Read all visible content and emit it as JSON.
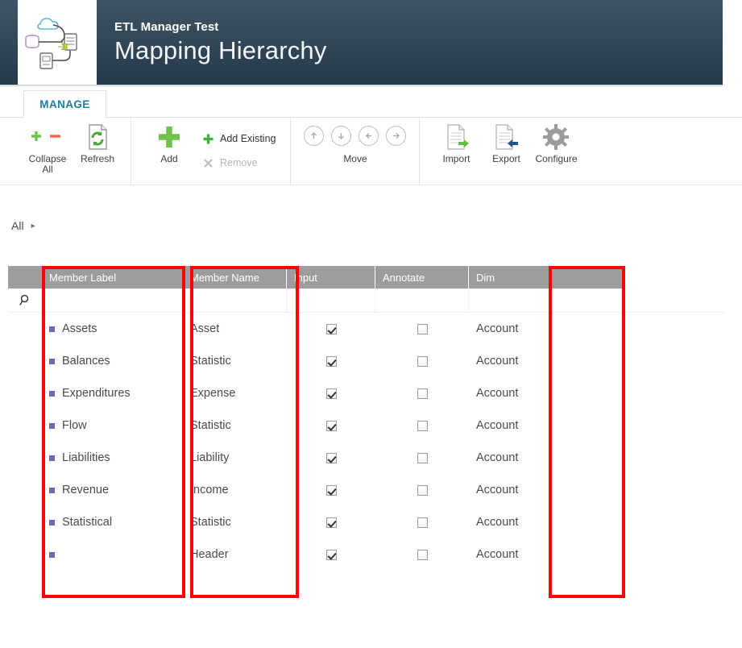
{
  "header": {
    "subtitle": "ETL Manager Test",
    "title": "Mapping Hierarchy",
    "logo_icon": "etl-dataflow-diagram-icon",
    "bg_top_color": "#3e5665",
    "bg_bottom_color": "#25394a"
  },
  "ribbon": {
    "tabs": [
      {
        "label": "MANAGE",
        "active": true
      }
    ],
    "tab_color": "#1a7fa5",
    "groups": [
      {
        "name": "view-group",
        "buttons": [
          {
            "label": "Collapse\nAll",
            "label_line1": "Collapse",
            "label_line2": "All",
            "icon": "expand-collapse-plus-minus-icon",
            "enabled": true
          },
          {
            "label": "Refresh",
            "icon": "refresh-page-icon",
            "enabled": true
          }
        ]
      },
      {
        "name": "edit-group",
        "buttons": [
          {
            "label": "Add",
            "icon": "plus-icon",
            "enabled": true
          },
          {
            "label": "Add Existing",
            "icon": "small-plus-icon",
            "enabled": true
          },
          {
            "label": "Remove",
            "icon": "x-mark-icon",
            "enabled": false
          }
        ]
      },
      {
        "name": "move-group",
        "label": "Move",
        "buttons": [
          {
            "icon": "arrow-up-circle-icon",
            "enabled": false
          },
          {
            "icon": "arrow-down-circle-icon",
            "enabled": false
          },
          {
            "icon": "arrow-left-circle-icon",
            "enabled": false
          },
          {
            "icon": "arrow-right-circle-icon",
            "enabled": false
          }
        ]
      },
      {
        "name": "data-group",
        "buttons": [
          {
            "label": "Import",
            "icon": "import-document-icon",
            "enabled": true
          },
          {
            "label": "Export",
            "icon": "export-document-icon",
            "enabled": true
          },
          {
            "label": "Configure",
            "icon": "gear-icon",
            "enabled": true
          }
        ]
      }
    ]
  },
  "breadcrumb": {
    "items": [
      "All"
    ],
    "separator": "▸"
  },
  "grid": {
    "filter_icon": "search-magnifier-icon",
    "columns": [
      {
        "key": "member_label",
        "label": "Member Label"
      },
      {
        "key": "member_name",
        "label": "Member Name"
      },
      {
        "key": "input",
        "label": "Input"
      },
      {
        "key": "annotate",
        "label": "Annotate"
      },
      {
        "key": "dim",
        "label": "Dim"
      }
    ],
    "header_bg": "#9d9d9d",
    "bullet_color": "#6a6ab4",
    "rows": [
      {
        "member_label": "Assets",
        "member_name": "Asset",
        "input": true,
        "annotate": false,
        "dim": "Account"
      },
      {
        "member_label": "Balances",
        "member_name": "Statistic",
        "input": true,
        "annotate": false,
        "dim": "Account"
      },
      {
        "member_label": "Expenditures",
        "member_name": "Expense",
        "input": true,
        "annotate": false,
        "dim": "Account"
      },
      {
        "member_label": "Flow",
        "member_name": "Statistic",
        "input": true,
        "annotate": false,
        "dim": "Account"
      },
      {
        "member_label": "Liabilities",
        "member_name": "Liability",
        "input": true,
        "annotate": false,
        "dim": "Account"
      },
      {
        "member_label": "Revenue",
        "member_name": "Income",
        "input": true,
        "annotate": false,
        "dim": "Account"
      },
      {
        "member_label": "Statistical",
        "member_name": "Statistic",
        "input": true,
        "annotate": false,
        "dim": "Account"
      },
      {
        "member_label": "",
        "member_name": "Header",
        "input": true,
        "annotate": false,
        "dim": "Account"
      }
    ]
  },
  "annotations": {
    "color": "#ff0000",
    "boxes": [
      {
        "name": "member-label-column-highlight"
      },
      {
        "name": "member-name-column-highlight"
      },
      {
        "name": "dim-column-highlight"
      }
    ]
  }
}
